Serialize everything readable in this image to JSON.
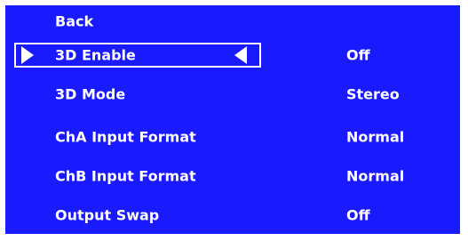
{
  "colors": {
    "panel_background": "#1a1aff",
    "text": "#ffffff",
    "highlight_border": "#ffffff"
  },
  "menu": {
    "back_label": "Back",
    "selected_index": 1,
    "items": [
      {
        "label": "3D Enable",
        "value": "Off"
      },
      {
        "label": "3D Mode",
        "value": "Stereo"
      },
      {
        "label": "ChA Input Format",
        "value": "Normal"
      },
      {
        "label": "ChB Input Format",
        "value": "Normal"
      },
      {
        "label": "Output Swap",
        "value": "Off"
      }
    ]
  },
  "icons": {
    "selection_left": "triangle-right-icon",
    "selection_right": "triangle-left-icon"
  }
}
